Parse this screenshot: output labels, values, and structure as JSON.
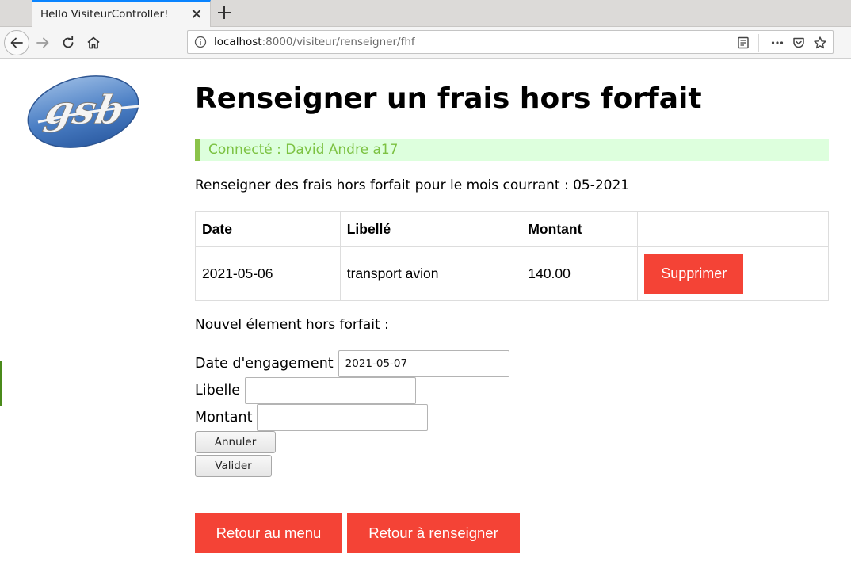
{
  "browser": {
    "tab_title": "Hello VisiteurController!",
    "url_host": "localhost",
    "url_path": ":8000/visiteur/renseigner/fhf",
    "icons": [
      "back-arrow-icon",
      "forward-arrow-icon",
      "reload-icon",
      "home-icon",
      "info-icon",
      "reader-view-icon",
      "more-icon",
      "pocket-icon",
      "star-icon"
    ]
  },
  "logo": {
    "text": "gsb"
  },
  "page": {
    "title": "Renseigner un frais hors forfait",
    "connected": "Connecté : David Andre a17",
    "intro": "Renseigner des frais hors forfait pour le mois courrant : 05-2021",
    "new_element": "Nouvel élement hors forfait :"
  },
  "table": {
    "headers": {
      "date": "Date",
      "libelle": "Libellé",
      "montant": "Montant",
      "action": ""
    },
    "rows": [
      {
        "date": "2021-05-06",
        "libelle": "transport avion",
        "montant": "140.00",
        "action": "Supprimer"
      }
    ]
  },
  "form": {
    "date_label": "Date d'engagement",
    "date_value": "2021-05-07",
    "libelle_label": "Libelle",
    "libelle_value": "",
    "montant_label": "Montant",
    "montant_value": "",
    "cancel_label": "Annuler",
    "submit_label": "Valider"
  },
  "actions": {
    "back_menu": "Retour au menu",
    "back_fill": "Retour à renseigner"
  },
  "colors": {
    "accent_red": "#f44336",
    "connected_bg": "#ddffdd",
    "connected_border": "#8bc34a",
    "connected_text": "#7cc242"
  }
}
